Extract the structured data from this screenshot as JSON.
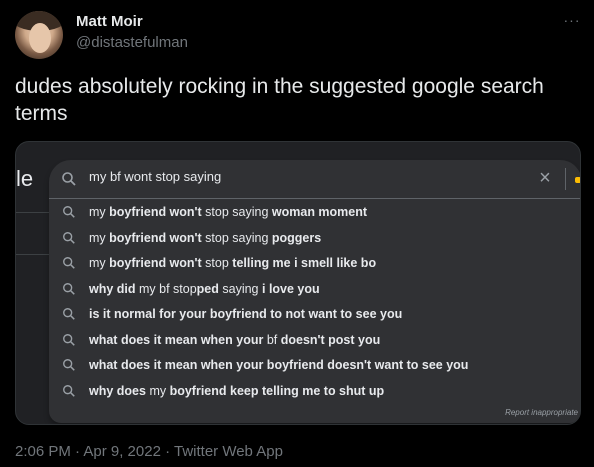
{
  "author": {
    "name": "Matt Moir",
    "handle": "@distastefulman"
  },
  "tweet": {
    "text": "dudes absolutely rocking in the suggested google search terms"
  },
  "more_icon": "more-horizontal-icon",
  "media": {
    "partial_logo": "le",
    "search": {
      "value": "my bf wont stop saying"
    },
    "report_link": "Report inappropriate",
    "suggestions": [
      [
        {
          "t": "my ",
          "b": false
        },
        {
          "t": "boyfriend won't",
          "b": true
        },
        {
          "t": " stop saying ",
          "b": false
        },
        {
          "t": "woman moment",
          "b": true
        }
      ],
      [
        {
          "t": "my ",
          "b": false
        },
        {
          "t": "boyfriend won't",
          "b": true
        },
        {
          "t": " stop saying ",
          "b": false
        },
        {
          "t": "poggers",
          "b": true
        }
      ],
      [
        {
          "t": "my ",
          "b": false
        },
        {
          "t": "boyfriend won't",
          "b": true
        },
        {
          "t": " stop ",
          "b": false
        },
        {
          "t": "telling me i smell like bo",
          "b": true
        }
      ],
      [
        {
          "t": "why did",
          "b": true
        },
        {
          "t": " my bf stop",
          "b": false
        },
        {
          "t": "ped",
          "b": true
        },
        {
          "t": " saying ",
          "b": false
        },
        {
          "t": "i love you",
          "b": true
        }
      ],
      [
        {
          "t": "is it normal for your boyfriend to not want to see you",
          "b": true
        }
      ],
      [
        {
          "t": "what does it mean when your",
          "b": true
        },
        {
          "t": " bf ",
          "b": false
        },
        {
          "t": "doesn't post you",
          "b": true
        }
      ],
      [
        {
          "t": "what does it mean when your boyfriend doesn't want to see you",
          "b": true
        }
      ],
      [
        {
          "t": "why does",
          "b": true
        },
        {
          "t": " my ",
          "b": false
        },
        {
          "t": "boyfriend keep telling me to shut up",
          "b": true
        }
      ]
    ]
  },
  "footer": {
    "timestamp": "2:06 PM · Apr 9, 2022 · Twitter Web App"
  },
  "colors": {
    "background": "#000000",
    "dropdown": "#303134",
    "text": "#e7e9ea",
    "muted": "#71767b"
  }
}
